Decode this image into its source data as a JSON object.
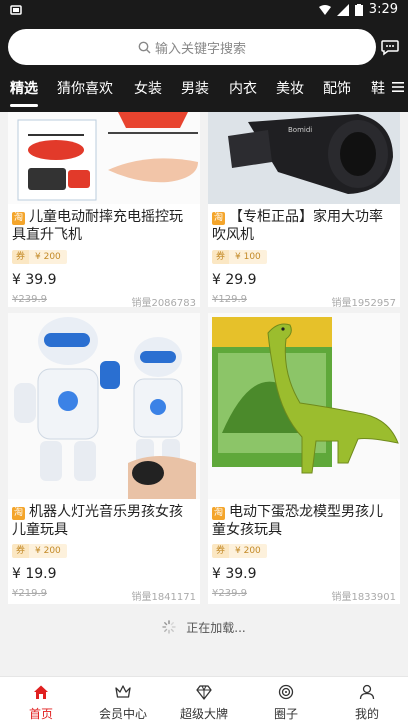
{
  "status": {
    "time": "3:29"
  },
  "search": {
    "placeholder": "输入关键字搜索"
  },
  "tabs": [
    {
      "label": "精选"
    },
    {
      "label": "猜你喜欢"
    },
    {
      "label": "女装"
    },
    {
      "label": "男装"
    },
    {
      "label": "内衣"
    },
    {
      "label": "美妆"
    },
    {
      "label": "配饰"
    },
    {
      "label": "鞋"
    }
  ],
  "products": [
    {
      "title": "儿童电动耐摔充电摇控玩具直升飞机",
      "tag": "淘",
      "coupon_label": "券",
      "coupon_value": "¥ 200",
      "price": "¥ 39.9",
      "original": "¥239.9",
      "sales": "销量2086783"
    },
    {
      "title": "【专柜正品】家用大功率吹风机",
      "tag": "淘",
      "coupon_label": "券",
      "coupon_value": "¥ 100",
      "price": "¥ 29.9",
      "original": "¥129.9",
      "sales": "销量1952957"
    },
    {
      "title": "机器人灯光音乐男孩女孩儿童玩具",
      "tag": "淘",
      "coupon_label": "券",
      "coupon_value": "¥ 200",
      "price": "¥ 19.9",
      "original": "¥219.9",
      "sales": "销量1841171"
    },
    {
      "title": "电动下蛋恐龙模型男孩儿童女孩玩具",
      "tag": "淘",
      "coupon_label": "券",
      "coupon_value": "¥ 200",
      "price": "¥ 39.9",
      "original": "¥239.9",
      "sales": "销量1833901"
    }
  ],
  "loading": {
    "text": "正在加载..."
  },
  "nav": [
    {
      "label": "首页",
      "icon": "home-icon"
    },
    {
      "label": "会员中心",
      "icon": "crown-icon"
    },
    {
      "label": "超级大牌",
      "icon": "diamond-icon"
    },
    {
      "label": "圈子",
      "icon": "circle-icon"
    },
    {
      "label": "我的",
      "icon": "user-icon"
    }
  ],
  "colors": {
    "header": "#1a1a1a",
    "accent": "#e02020",
    "coupon": "#f4a52b"
  }
}
